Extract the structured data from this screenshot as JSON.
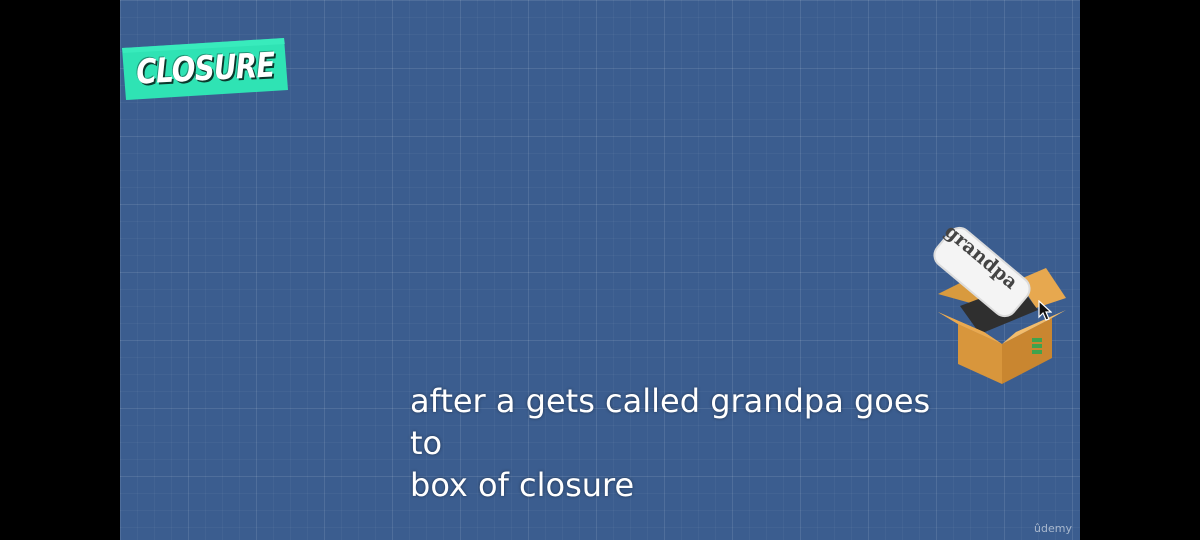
{
  "slide": {
    "title": "CLOSURE",
    "tag_text": "grandpa",
    "caption": "after a gets called grandpa goes to\n box of closure",
    "watermark": "ûdemy"
  },
  "colors": {
    "background": "#000000",
    "slide_background": "#3b5d8f",
    "title_banner": "#2fe3b4",
    "box": "#e7a84f",
    "caption_text": "#ffffff"
  },
  "icons": {
    "box": "open-cardboard-box-icon",
    "cursor": "mouse-pointer-icon"
  }
}
